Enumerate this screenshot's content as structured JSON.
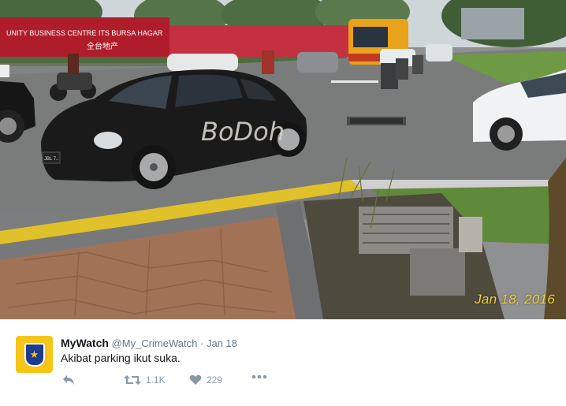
{
  "photo": {
    "date_stamp": "Jan 18, 2016",
    "graffiti_text": "BoDoh",
    "billboard_text": "UNITY BUSINESS CENTRE ITS BURSA HAGAR",
    "billboard_chinese": "全台地产",
    "plate_text": "JBL 7..",
    "colors": {
      "asphalt": "#7c7d7e",
      "car": "#1a1a1a",
      "grass": "#5f8a3a",
      "curb": "#e0c12a",
      "billboard": "#b01d2a",
      "bus": "#e8a21c"
    }
  },
  "tweet": {
    "name": "MyWatch",
    "handle": "@My_CrimeWatch",
    "separator": "·",
    "time": "Jan 18",
    "text": "Akibat parking ikut suka.",
    "retweets": "1.1K",
    "likes": "229",
    "avatar_glyph": "★"
  },
  "icons": {
    "reply": "reply-icon",
    "retweet": "retweet-icon",
    "like": "heart-icon",
    "more": "more-icon"
  }
}
